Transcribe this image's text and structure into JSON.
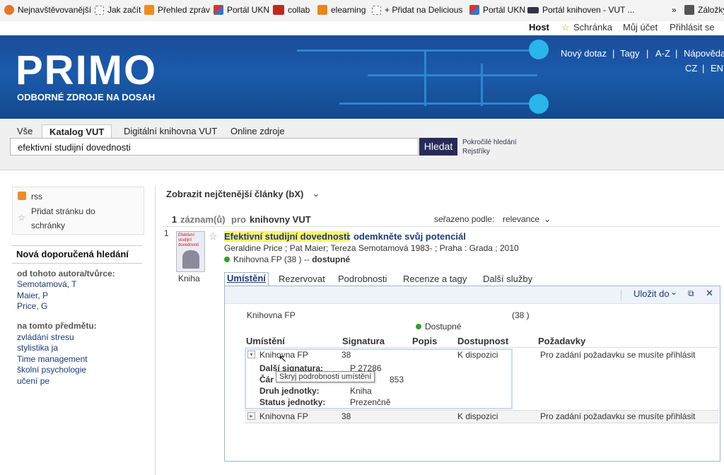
{
  "bookmarks": [
    {
      "label": "Nejnavštěvovanější",
      "icon": "firefox-icon"
    },
    {
      "label": "Jak začít",
      "icon": "page-icon"
    },
    {
      "label": "Přehled zpráv",
      "icon": "rss-icon"
    },
    {
      "label": "Portál UKN",
      "icon": "puzzle-icon"
    },
    {
      "label": "collab",
      "icon": "oc-icon"
    },
    {
      "label": "elearning",
      "icon": "moodle-icon"
    },
    {
      "label": "+ Přidat na Delicious",
      "icon": "page-icon"
    },
    {
      "label": "Portál UKN",
      "icon": "puzzle-icon"
    },
    {
      "label": "Portál knihoven - VUT ...",
      "icon": "vut-icon"
    },
    {
      "label": "»",
      "icon": ""
    },
    {
      "label": "Záložky",
      "icon": "bookmarks-icon"
    }
  ],
  "util": {
    "host": "Host",
    "schranka": "Schránka",
    "ucet": "Můj účet",
    "login": "Přihlásit se"
  },
  "banner": {
    "logo": "PRIMO",
    "subtitle": "ODBORNÉ ZDROJE NA DOSAH",
    "nav": [
      "Nový dotaz",
      "Tagy",
      "A-Z",
      "Nápověda",
      "CZ",
      "EN"
    ]
  },
  "search": {
    "tabs": [
      "Vše",
      "Katalog VUT",
      "Digitální knihovna VUT",
      "Online zdroje"
    ],
    "query": "efektivní studijní dovednosti",
    "button": "Hledat",
    "advanced": "Pokročilé hledání",
    "registry": "Rejstříky"
  },
  "left": {
    "rss": "rss",
    "add_line1": "Přidat stránku do",
    "add_line2": "schránky",
    "heading": "Nová doporučená hledání",
    "author_head": "od tohoto autora/tvůrce:",
    "authors": [
      "Semotamová, T",
      "Maier, P",
      "Price, G"
    ],
    "subject_head": "na tomto předmětu:",
    "subjects": [
      "zvládání stresu",
      "stylistika ja",
      "Time management",
      "školní psychologie",
      "učení pe"
    ]
  },
  "results": {
    "newest": "Zobrazit nejčtenější články (bX)",
    "count": "1",
    "count_label": "záznam(ů)",
    "pro": "pro",
    "library": "knihovny VUT",
    "sorted_label": "seřazeno podle:",
    "sorted_value": "relevance"
  },
  "record": {
    "num": "1",
    "cover_text": "Efektivní studijní dovednosti",
    "type": "Kniha",
    "title_hl": "Efektivní studijní dovednosti",
    "title_rest": " : odemkněte svůj potenciál",
    "authors": "Geraldine Price ; Pat Maier; Tereza Semotamová 1983- ; Praha : Grada ; 2010",
    "avail_lib": "Knihovna FP",
    "avail_count": "(38 )",
    "avail_sep": "--",
    "avail_status": "dostupné",
    "tabs": [
      "Umístění",
      "Rezervovat",
      "Podrobnosti",
      "Recenze a tagy",
      "Další služby"
    ]
  },
  "panel": {
    "save": "Uložit do",
    "lib": "Knihovna FP",
    "count": "(38 )",
    "status": "Dostupné",
    "headers": [
      "Umístění",
      "Signatura",
      "Popis",
      "Dostupnost",
      "Požadavky"
    ],
    "rows": [
      {
        "loc": "Knihovna FP",
        "sig": "38",
        "avail": "K dispozici",
        "req": "Pro zadání požadavku se musíte přihlásit"
      },
      {
        "loc": "Knihovna FP",
        "sig": "38",
        "avail": "K dispozici",
        "req": "Pro zadání požadavku se musíte přihlásit"
      }
    ],
    "details": [
      {
        "label": "Další signatura:",
        "value": "P 27286"
      },
      {
        "label": "Čár",
        "value": "853"
      },
      {
        "label": "Druh jednotky:",
        "value": "Kniha"
      },
      {
        "label": "Status jednotky:",
        "value": "Prezenčně"
      }
    ],
    "tooltip": "Skryj podrobnosti umístění"
  },
  "colors": {
    "accent": "#1a3a7a",
    "banner": "#1b5aab",
    "button": "#2a2a5a",
    "available": "#2ea02e",
    "highlight": "#fff26b"
  }
}
